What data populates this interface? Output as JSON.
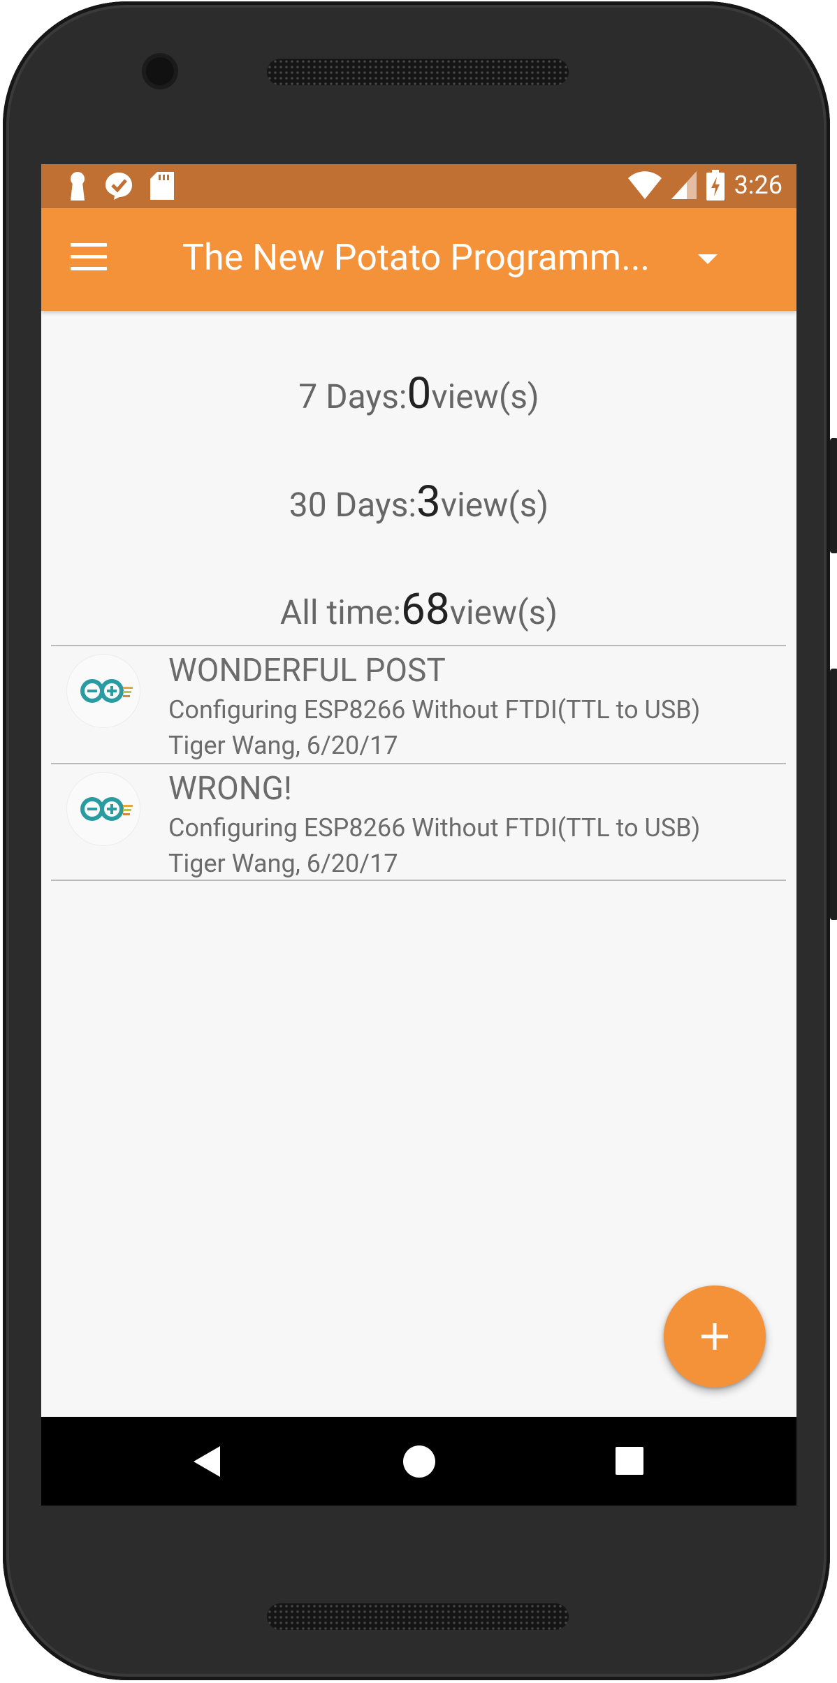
{
  "status_bar": {
    "time": "3:26",
    "icons_left": [
      "keyhole-icon",
      "check-badge-icon",
      "sd-card-icon"
    ],
    "icons_right": [
      "wifi-icon",
      "signal-icon",
      "battery-charging-icon"
    ]
  },
  "app_bar": {
    "title": "The New Potato Programm...",
    "menu_icon": "hamburger-menu-icon",
    "dropdown_icon": "dropdown-triangle-icon"
  },
  "stats": [
    {
      "prefix": "7 Days:",
      "value": "0",
      "suffix": "view(s)"
    },
    {
      "prefix": "30 Days:",
      "value": "3",
      "suffix": "view(s)"
    },
    {
      "prefix": "All time:",
      "value": "68",
      "suffix": "view(s)"
    }
  ],
  "posts": [
    {
      "title": "WONDERFUL POST",
      "description": "Configuring ESP8266 Without FTDI(TTL to USB)",
      "meta": "Tiger Wang, 6/20/17",
      "avatar_icon": "arduino-logo-icon"
    },
    {
      "title": "WRONG!",
      "description": "Configuring ESP8266 Without FTDI(TTL to USB)",
      "meta": "Tiger Wang, 6/20/17",
      "avatar_icon": "arduino-logo-icon"
    }
  ],
  "fab": {
    "icon": "plus-icon"
  },
  "nav_bar": {
    "icons": [
      "back-icon",
      "home-icon",
      "recents-icon"
    ]
  },
  "colors": {
    "accent": "#f4923a",
    "status_bar": "#c07033",
    "background": "#f7f7f7",
    "phone_body": "#2c2c2c"
  }
}
